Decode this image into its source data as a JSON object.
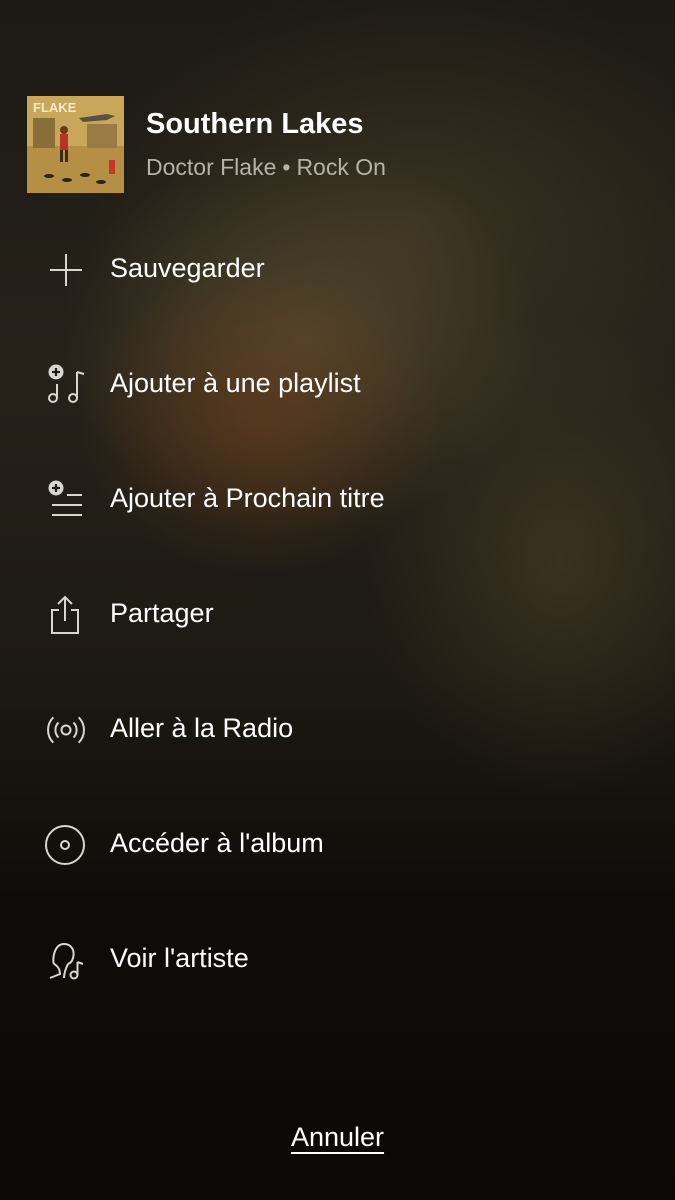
{
  "track": {
    "title": "Southern Lakes",
    "artist": "Doctor Flake",
    "separator": "•",
    "album": "Rock On",
    "album_art_text": "FLAKE"
  },
  "menu": [
    {
      "label": "Sauvegarder",
      "icon": "plus-icon"
    },
    {
      "label": "Ajouter à une playlist",
      "icon": "add-to-playlist-icon"
    },
    {
      "label": "Ajouter à Prochain titre",
      "icon": "add-to-queue-icon"
    },
    {
      "label": "Partager",
      "icon": "share-icon"
    },
    {
      "label": "Aller à la Radio",
      "icon": "radio-icon"
    },
    {
      "label": "Accéder à l'album",
      "icon": "album-icon"
    },
    {
      "label": "Voir l'artiste",
      "icon": "artist-icon"
    }
  ],
  "cancel_label": "Annuler",
  "colors": {
    "text": "#ffffff",
    "subtext": "#b7b2a6",
    "background": "#1c1a14"
  }
}
